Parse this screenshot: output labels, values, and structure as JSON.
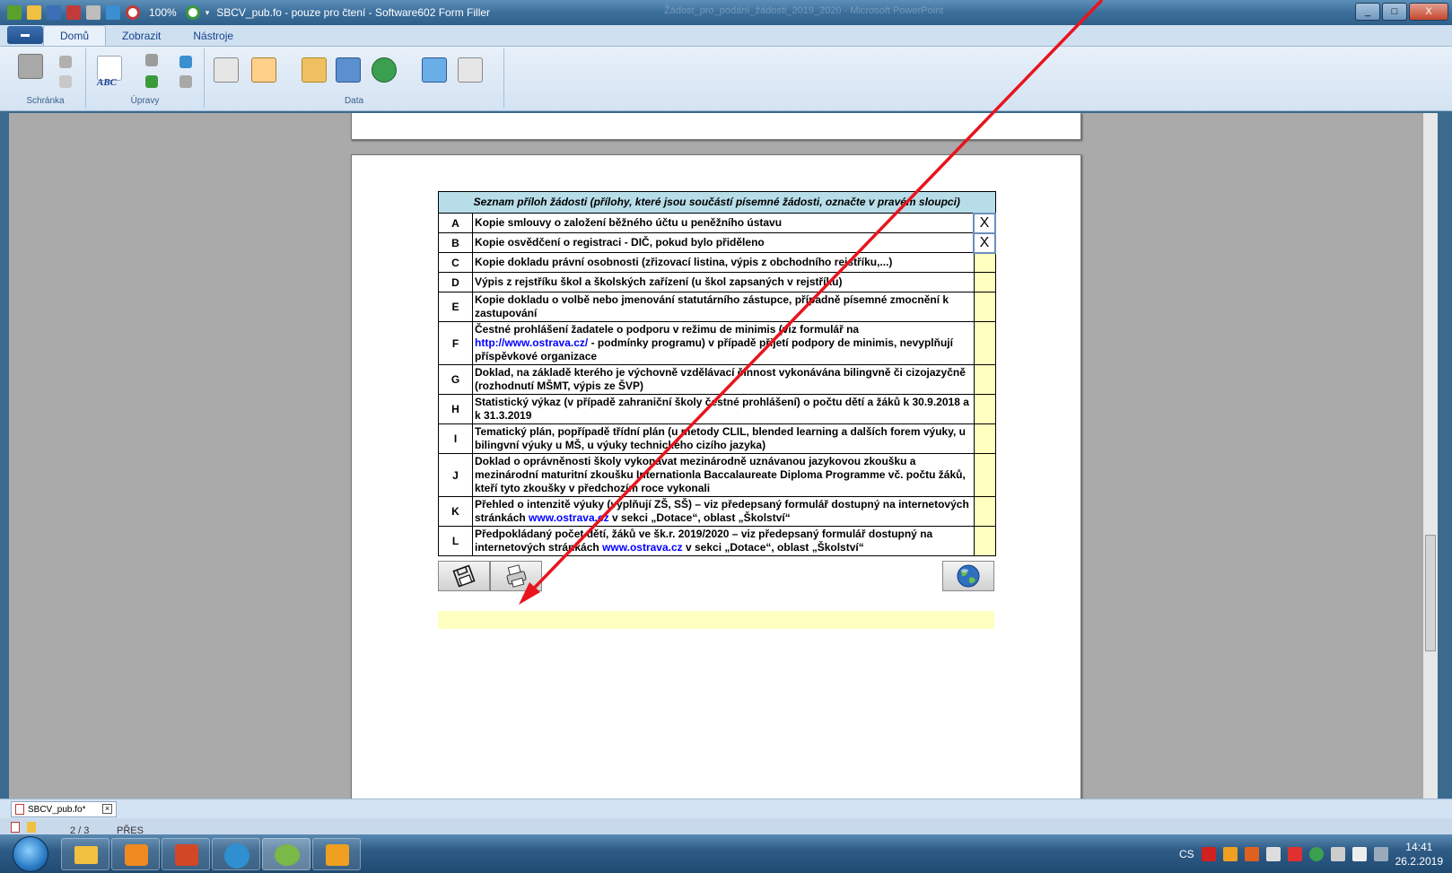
{
  "window": {
    "zoom": "100%",
    "title": "SBCV_pub.fo - pouze pro čtení - Software602 Form Filler",
    "bg_title": "Žádost_pro_podání_žádosti_2019_2020 - Microsoft PowerPoint",
    "min": "_",
    "max": "□",
    "close": "X"
  },
  "ribbon": {
    "app_button": "▬",
    "tabs": [
      "Domů",
      "Zobrazit",
      "Nástroje"
    ],
    "groups": {
      "clipboard": "Schránka",
      "edit": "Úpravy",
      "data": "Data"
    },
    "abc_label": "ABC"
  },
  "form": {
    "header": "Seznam příloh žádosti (přílohy, které jsou součástí písemné žádosti, označte v pravém sloupci)",
    "rows": [
      {
        "letter": "A",
        "text": "Kopie smlouvy o založení běžného účtu u peněžního ústavu",
        "mark": "X"
      },
      {
        "letter": "B",
        "text": "Kopie osvědčení o registraci - DIČ, pokud bylo přiděleno",
        "mark": "X"
      },
      {
        "letter": "C",
        "text": "Kopie dokladu právní osobnosti (zřizovací listina, výpis z obchodního rejstříku,...)",
        "mark": ""
      },
      {
        "letter": "D",
        "text": "Výpis z rejstříku škol a školských zařízení (u škol zapsaných v rejstříku)",
        "mark": ""
      },
      {
        "letter": "E",
        "text": "Kopie dokladu o volbě nebo jmenování statutárního zástupce, případně písemné zmocnění k zastupování",
        "mark": ""
      },
      {
        "letter": "F",
        "text_a": "Čestné prohlášení žadatele o podporu v režimu de minimis (viz formulář na ",
        "link": "http://www.ostrava.cz/",
        "text_b": " - podmínky programu) v případě přijetí podpory de minimis, nevyplňují příspěvkové organizace",
        "mark": ""
      },
      {
        "letter": "G",
        "text": "Doklad, na základě kterého je výchovně vzdělávací činnost vykonávána bilingvně či cizojazyčně (rozhodnutí MŠMT, výpis ze ŠVP)",
        "mark": ""
      },
      {
        "letter": "H",
        "text": "Statistický výkaz (v případě zahraniční školy čestné prohlášení) o počtu dětí a žáků k 30.9.2018 a k 31.3.2019",
        "mark": ""
      },
      {
        "letter": "I",
        "text": "Tematický plán, popřípadě třídní plán (u metody CLIL, blended learning a dalších forem výuky, u bilingvní výuky u MŠ, u výuky technického cizího jazyka)",
        "mark": ""
      },
      {
        "letter": "J",
        "text": "Doklad o oprávněnosti školy vykonávat mezinárodně uznávanou jazykovou zkoušku a mezinárodní maturitní zkoušku Internationla Baccalaureate Diploma Programme vč. počtu žáků, kteří tyto zkoušky v předchozím roce vykonali",
        "mark": ""
      },
      {
        "letter": "K",
        "text_a": "Přehled o intenzitě výuky (vyplňují ZŠ, SŠ) – viz předepsaný formulář dostupný na internetových stránkách ",
        "link": "www.ostrava.cz",
        "text_b": " v sekci „Dotace“, oblast „Školství“",
        "mark": ""
      },
      {
        "letter": "L",
        "text_a": "Předpokládaný počet dětí, žáků ve šk.r. 2019/2020 – viz předepsaný formulář dostupný na internetových stránkách ",
        "link": "www.ostrava.cz",
        "text_b": " v sekci „Dotace“, oblast „Školství“",
        "mark": ""
      }
    ]
  },
  "doc_tab": {
    "name": "SBCV_pub.fo*",
    "close": "×"
  },
  "status": {
    "page": "2 / 3",
    "mode": "PŘES"
  },
  "tray": {
    "lang": "CS",
    "time": "14:41",
    "date": "26.2.2019"
  },
  "colors": {
    "header_bg": "#b7dde8",
    "check_bg": "#ffffc0",
    "arrow": "#e8141e",
    "link": "#0000ff"
  }
}
